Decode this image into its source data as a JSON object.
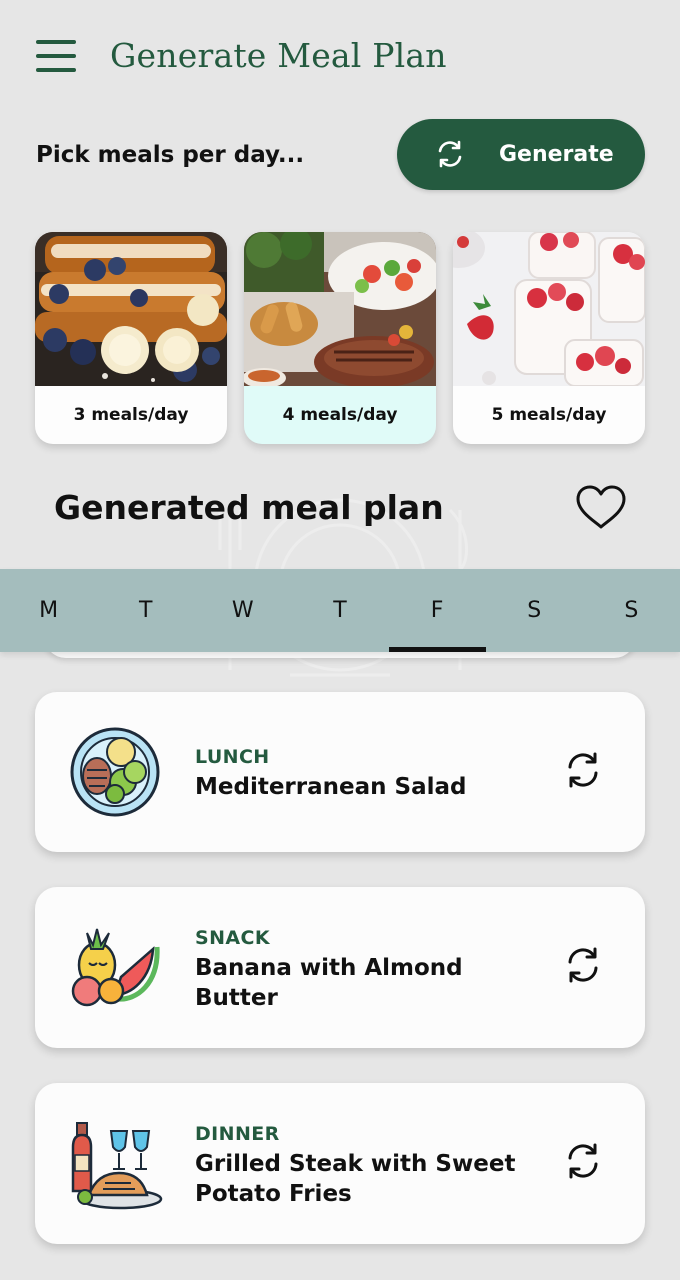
{
  "header": {
    "title": "Generate Meal Plan",
    "menu_icon": "hamburger-menu-icon"
  },
  "picker": {
    "label": "Pick meals per day...",
    "generate_label": "Generate",
    "generate_icon": "refresh-icon",
    "options": [
      {
        "label": "3 meals/day",
        "photo": "french-toast-blueberries-banana",
        "selected": false
      },
      {
        "label": "4 meals/day",
        "photo": "steak-fries-salad-platter",
        "selected": true
      },
      {
        "label": "5 meals/day",
        "photo": "strawberry-panna-cotta-jars",
        "selected": false
      }
    ]
  },
  "plan": {
    "title": "Generated meal plan",
    "favorite_icon": "heart-outline-icon"
  },
  "days": {
    "items": [
      "M",
      "T",
      "W",
      "T",
      "F",
      "S",
      "S"
    ],
    "active_index": 4
  },
  "meals": [
    {
      "type": "LUNCH",
      "name": "Mediterranean Salad",
      "icon": "salad-plate-icon"
    },
    {
      "type": "SNACK",
      "name": "Banana with Almond Butter",
      "icon": "fruit-assortment-icon"
    },
    {
      "type": "DINNER",
      "name": "Grilled Steak with Sweet Potato Fries",
      "icon": "dinner-wine-roast-icon"
    }
  ],
  "colors": {
    "brand": "#245a3f",
    "background": "#e6e6e6",
    "day_bar": "#a4bdbd",
    "selected_card": "#e0fbf8"
  }
}
